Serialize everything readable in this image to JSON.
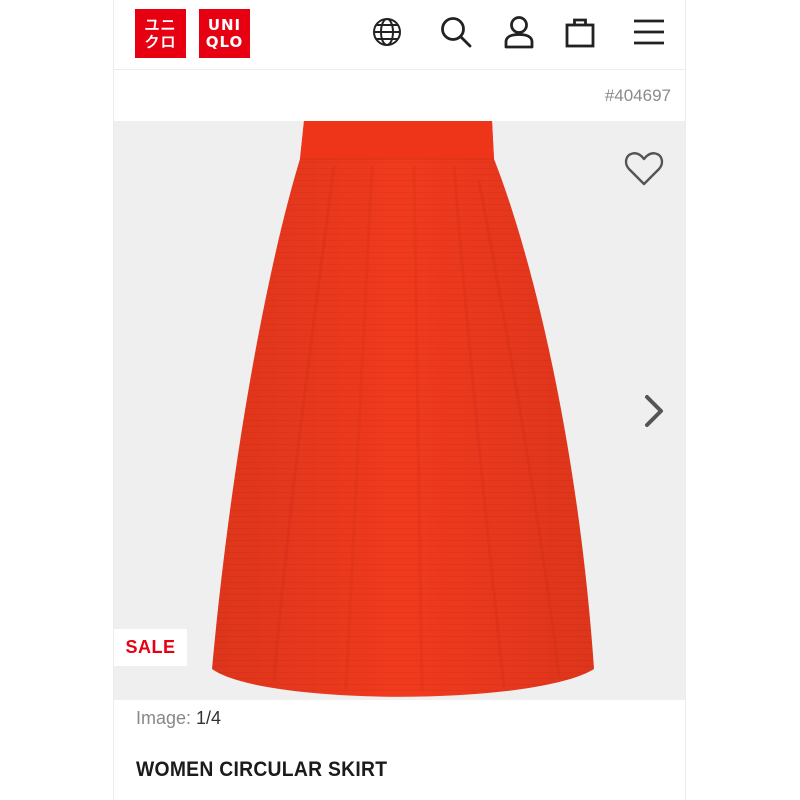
{
  "header": {
    "logo_jp": [
      "ユニ",
      "クロ"
    ],
    "logo_en": [
      "UNI",
      "QLO"
    ],
    "brand_color": "#e60012",
    "icons": [
      "globe-icon",
      "search-icon",
      "account-icon",
      "shopping-bag-icon",
      "menu-icon"
    ]
  },
  "product": {
    "id": "#404697",
    "badge": "SALE",
    "image_counter_label": "Image:",
    "image_counter_value": "1/4",
    "name": "WOMEN CIRCULAR SKIRT",
    "skirt_color": "#f03a1e"
  }
}
